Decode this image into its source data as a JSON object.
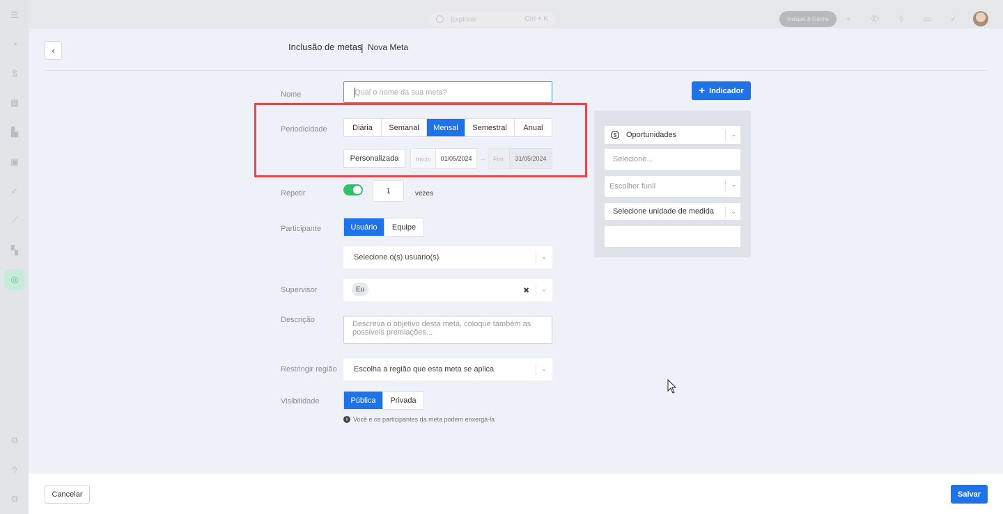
{
  "topbar": {
    "search_placeholder": "Explorar",
    "search_shortcut": "Ctrl + K",
    "cta_label": "Indique & Ganhe"
  },
  "header": {
    "title": "Inclusão de metas",
    "separator": "|",
    "subtitle": "Nova Meta"
  },
  "form": {
    "name": {
      "label": "Nome",
      "placeholder": "Qual o nome da sua meta?"
    },
    "periodicity": {
      "label": "Periodicidade",
      "options": [
        "Diária",
        "Semanal",
        "Mensal",
        "Semestral",
        "Anual"
      ],
      "selected": "Mensal",
      "custom_label": "Personalizada",
      "start_label": "Início",
      "start_value": "01/05/2024",
      "range_sep": "–",
      "end_label": "Fim",
      "end_value": "31/05/2024"
    },
    "repeat": {
      "label": "Repetir",
      "enabled": true,
      "count": "1",
      "unit": "vezes"
    },
    "participant": {
      "label": "Participante",
      "options": [
        "Usuário",
        "Equipe"
      ],
      "selected": "Usuário",
      "users_placeholder": "Selecione o(s) usuario(s)"
    },
    "supervisor": {
      "label": "Supervisor",
      "chip": "Eu",
      "clear": "✖"
    },
    "description": {
      "label": "Descrição",
      "placeholder": "Descreva o objetivo desta meta, coloque também as possíveis premiações..."
    },
    "region": {
      "label": "Restringir região",
      "placeholder": "Escolha a região que esta meta se aplica"
    },
    "visibility": {
      "label": "Visibilidade",
      "options": [
        "Pública",
        "Privada"
      ],
      "selected": "Pública",
      "info": "Você e os participantes da meta podem enxergá-la"
    }
  },
  "indicator": {
    "add_label": "Indicador",
    "type_value": "Oportunidades",
    "select_placeholder": "Selecione...",
    "funnel_placeholder": "Escolher funil",
    "unit_placeholder": "Selecione unidade de medida",
    "value": ""
  },
  "footer": {
    "cancel_label": "Cancelar",
    "save_label": "Salvar"
  },
  "colors": {
    "primary": "#1f73e8",
    "toggle_on": "#32c167",
    "highlight": "#e5484d"
  }
}
